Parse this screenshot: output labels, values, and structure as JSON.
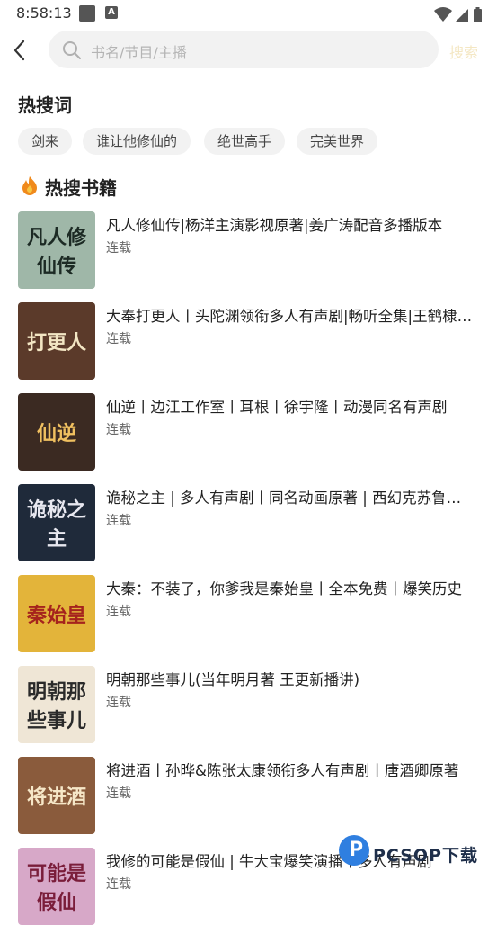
{
  "status_bar": {
    "time": "8:58:13",
    "badge": "A"
  },
  "search": {
    "placeholder": "书名/节目/主播",
    "button_label": "搜索"
  },
  "hot_words": {
    "title": "热搜词",
    "chips": [
      "剑来",
      "谁让他修仙的",
      "绝世高手",
      "完美世界"
    ]
  },
  "hot_books": {
    "title": "热搜书籍",
    "items": [
      {
        "title": "凡人修仙传|杨洋主演影视原著|姜广涛配音多播版本",
        "status": "连载",
        "cover_text": "凡人修仙传",
        "cover_bg": "#9fb7a8",
        "cover_fg": "#1c2a24"
      },
      {
        "title": "大奉打更人丨头陀渊领衔多人有声剧|畅听全集|王鹤棣主演影视原著",
        "status": "连载",
        "cover_text": "打更人",
        "cover_bg": "#5b3a2a",
        "cover_fg": "#f3e6c4"
      },
      {
        "title": "仙逆丨边江工作室丨耳根丨徐宇隆丨动漫同名有声剧",
        "status": "连载",
        "cover_text": "仙逆",
        "cover_bg": "#3b2a22",
        "cover_fg": "#f0c060"
      },
      {
        "title": "诡秘之主 | 多人有声剧丨同名动画原著 | 西幻克苏鲁神作",
        "status": "连载",
        "cover_text": "诡秘之主",
        "cover_bg": "#1f2a3a",
        "cover_fg": "#e8e8f0"
      },
      {
        "title": "大秦：不装了，你爹我是秦始皇丨全本免费丨爆笑历史",
        "status": "连载",
        "cover_text": "秦始皇",
        "cover_bg": "#e3b43a",
        "cover_fg": "#a5231d"
      },
      {
        "title": "明朝那些事儿(当年明月著 王更新播讲)",
        "status": "连载",
        "cover_text": "明朝那些事儿",
        "cover_bg": "#efe6d6",
        "cover_fg": "#2a2a2a"
      },
      {
        "title": "将进酒丨孙晔&陈张太康领衔多人有声剧丨唐酒卿原著",
        "status": "连载",
        "cover_text": "将进酒",
        "cover_bg": "#8a5b3c",
        "cover_fg": "#f6e7c8"
      },
      {
        "title": "我修的可能是假仙 | 牛大宝爆笑演播丨多人有声剧",
        "status": "连载",
        "cover_text": "可能是假仙",
        "cover_bg": "#d7a8c8",
        "cover_fg": "#7a1d3a"
      }
    ]
  },
  "watermark": {
    "letter": "P",
    "text": "PCSOP下载"
  },
  "colors": {
    "search_button": "#f4e7c3",
    "chip_bg": "#f2f2f2",
    "fire_outer": "#f08a1c",
    "fire_inner": "#f7c643"
  }
}
